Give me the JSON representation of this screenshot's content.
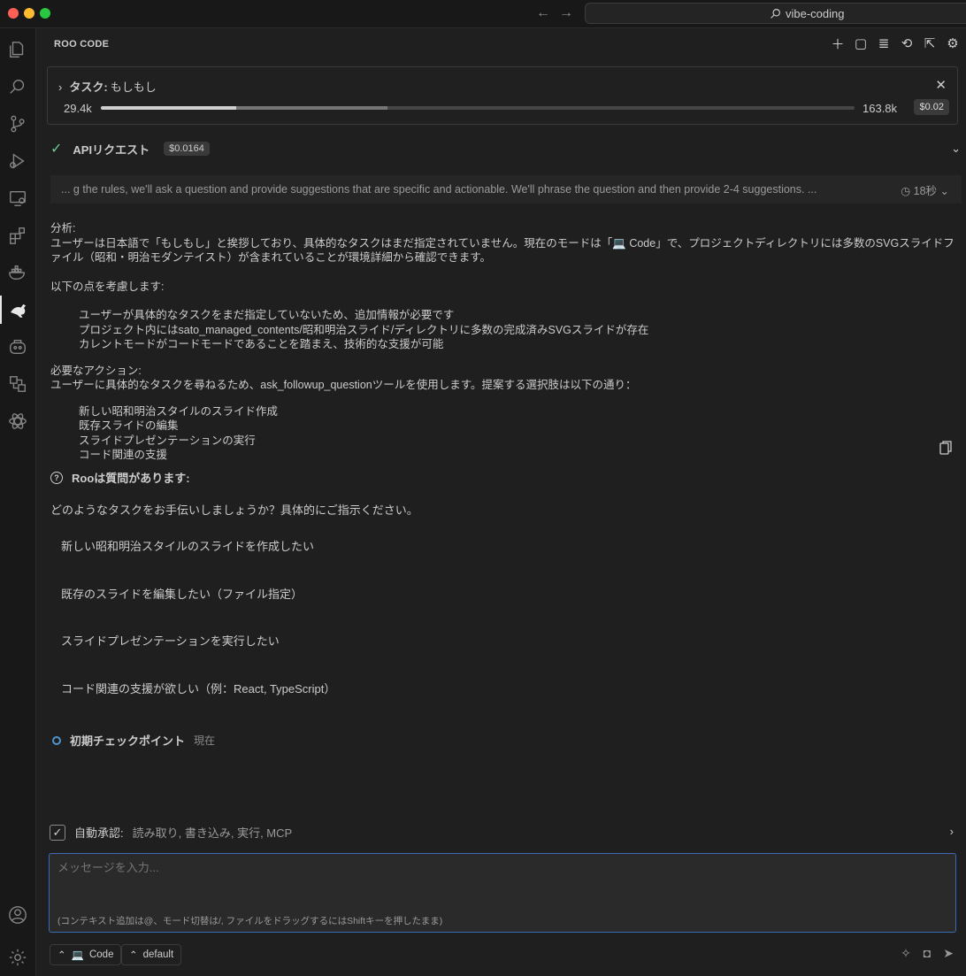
{
  "window": {
    "search_text": "vibe-coding",
    "colors": {
      "close": "#ff5f57",
      "minimize": "#febc2e",
      "zoom": "#28c840",
      "accent": "#3e6ab3",
      "success": "#73c991"
    }
  },
  "panel": {
    "title": "ROO CODE"
  },
  "task": {
    "label": "タスク:",
    "text": "もしもし",
    "tokens_used": "29.4k",
    "context_window": "163.8k",
    "cost": "$0.02",
    "usage_fraction": 0.18,
    "reserved_fraction": 0.38
  },
  "api_request": {
    "label": "APIリクエスト",
    "cost": "$0.0164"
  },
  "thinking": {
    "text": "... g the rules, we'll ask a question and provide suggestions that are specific and actionable. We'll phrase the question and then provide 2-4 suggestions. ...",
    "time": "18秒"
  },
  "analysis": {
    "heading": "分析:",
    "intro_a": "ユーザーは日本語で「もしもし」と挨拶しており、具体的なタスクはまだ指定されていません。現在のモードは「",
    "intro_b": " Code」で、プロジェクトディレクトリには多数のSVGスライドファイル（昭和・明治モダンテイスト）が含まれていることが環境詳細から確認できます。",
    "consider_heading": "以下の点を考慮します:",
    "points": [
      "ユーザーが具体的なタスクをまだ指定していないため、追加情報が必要です",
      "プロジェクト内にはsato_managed_contents/昭和明治スライド/ディレクトリに多数の完成済みSVGスライドが存在",
      "カレントモードがコードモードであることを踏まえ、技術的な支援が可能"
    ],
    "action_heading": "必要なアクション:",
    "action_text": "ユーザーに具体的なタスクを尋ねるため、ask_followup_questionツールを使用します。提案する選択肢は以下の通り：",
    "options": [
      "新しい昭和明治スタイルのスライド作成",
      "既存スライドの編集",
      "スライドプレゼンテーションの実行",
      "コード関連の支援"
    ]
  },
  "question": {
    "title": "Rooは質問があります:",
    "text": "どのようなタスクをお手伝いしましょうか？具体的にご指示ください。",
    "suggestions": [
      "新しい昭和明治スタイルのスライドを作成したい",
      "既存のスライドを編集したい（ファイル指定）",
      "スライドプレゼンテーションを実行したい",
      "コード関連の支援が欲しい（例：React, TypeScript）"
    ]
  },
  "checkpoint": {
    "label": "初期チェックポイント",
    "status": "現在"
  },
  "auto_approve": {
    "label": "自動承認:",
    "value": "読み取り, 書き込み, 実行, MCP",
    "checked": true
  },
  "input": {
    "placeholder": "メッセージを入力...",
    "hint": "(コンテキスト追加は@、モード切替は/, ファイルをドラッグするにはShiftキーを押したまま)"
  },
  "mode": {
    "label": "Code",
    "icon": "laptop-icon"
  },
  "profile": {
    "label": "default"
  }
}
